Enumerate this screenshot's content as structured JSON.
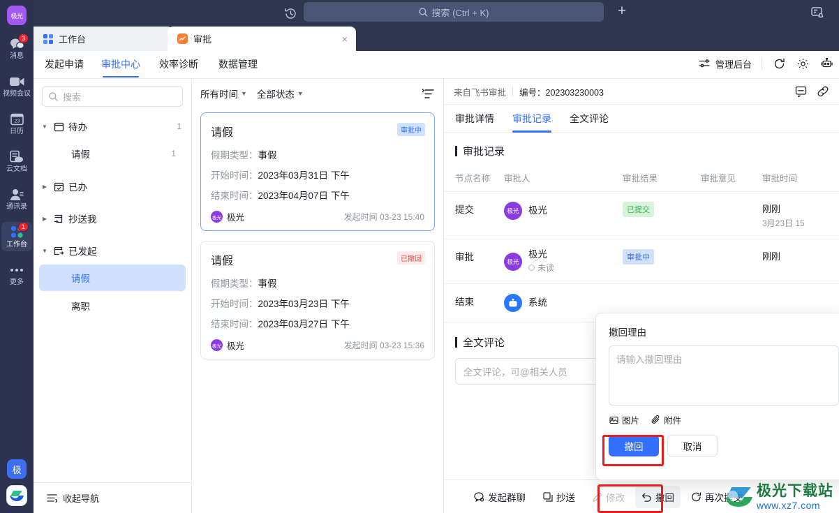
{
  "rail": {
    "avatar_label": "极光",
    "items": [
      {
        "label": "消息",
        "icon": "chat-icon",
        "badge": "3",
        "active": false
      },
      {
        "label": "视频会议",
        "icon": "video-icon",
        "badge": "",
        "active": false
      },
      {
        "label": "日历",
        "icon": "calendar-icon",
        "badge": "",
        "active": false
      },
      {
        "label": "云文档",
        "icon": "cloud-doc-icon",
        "badge": "",
        "active": false
      },
      {
        "label": "通讯录",
        "icon": "contacts-icon",
        "badge": "",
        "active": false
      },
      {
        "label": "工作台",
        "icon": "workbench-icon",
        "badge": "1",
        "active": true
      },
      {
        "label": "更多",
        "icon": "more-dots-icon",
        "badge": "",
        "active": false
      }
    ],
    "bottom_square_label": "极",
    "calendar_day": "23"
  },
  "topbar": {
    "history_icon": "history-icon",
    "search_placeholder": "搜索 (Ctrl + K)",
    "plus_label": "+",
    "notice_icon": "screen-bell-icon"
  },
  "tabs": [
    {
      "label": "工作台",
      "icon": "grid-icon",
      "active": false,
      "closable": false
    },
    {
      "label": "审批",
      "icon": "approval-icon",
      "active": true,
      "closable": true,
      "close_label": "×"
    }
  ],
  "nav": {
    "tabs": [
      {
        "label": "发起申请",
        "active": false
      },
      {
        "label": "审批中心",
        "active": true
      },
      {
        "label": "效率诊断",
        "active": false
      },
      {
        "label": "数据管理",
        "active": false
      }
    ],
    "admin_label": "管理后台",
    "icons": [
      "sliders-icon",
      "refresh-icon",
      "gear-icon",
      "robot-icon"
    ]
  },
  "tree": {
    "search_placeholder": "搜索",
    "groups": [
      {
        "label": "待办",
        "icon": "todo-icon",
        "expanded": true,
        "count": "1",
        "children": [
          {
            "label": "请假",
            "count": "1",
            "selected": false
          }
        ]
      },
      {
        "label": "已办",
        "icon": "done-icon",
        "expanded": false,
        "count": "",
        "children": []
      },
      {
        "label": "抄送我",
        "icon": "cc-icon",
        "expanded": false,
        "count": "",
        "children": []
      },
      {
        "label": "已发起",
        "icon": "initiated-icon",
        "expanded": true,
        "count": "",
        "children": [
          {
            "label": "请假",
            "count": "",
            "selected": true
          },
          {
            "label": "离职",
            "count": "",
            "selected": false
          }
        ]
      }
    ],
    "collapse_label": "收起导航"
  },
  "list": {
    "filters": [
      {
        "label": "所有时间"
      },
      {
        "label": "全部状态"
      }
    ],
    "sort_icon": "sort-icon",
    "cards": [
      {
        "title": "请假",
        "status": "审批中",
        "status_kind": "blue",
        "active": true,
        "fields": [
          {
            "key": "假期类型：",
            "value": "事假"
          },
          {
            "key": "开始时间：",
            "value": "2023年03月31日 下午"
          },
          {
            "key": "结束时间：",
            "value": "2023年04月07日 下午"
          }
        ],
        "author": "极光",
        "avatar_text": "极光",
        "time": "发起时间 03-23 15:40"
      },
      {
        "title": "请假",
        "status": "已撤回",
        "status_kind": "red",
        "active": false,
        "fields": [
          {
            "key": "假期类型：",
            "value": "事假"
          },
          {
            "key": "开始时间：",
            "value": "2023年03月23日 下午"
          },
          {
            "key": "结束时间：",
            "value": "2023年03月27日 下午"
          }
        ],
        "author": "极光",
        "avatar_text": "极光",
        "time": "发起时间 03-23 15:36"
      }
    ]
  },
  "detail": {
    "source": "来自飞书审批",
    "number": "编号：202303230003",
    "head_icons": [
      "comment-icon",
      "link-icon"
    ],
    "tabs": [
      {
        "label": "审批详情",
        "active": false
      },
      {
        "label": "审批记录",
        "active": true
      },
      {
        "label": "全文评论",
        "active": false
      }
    ],
    "record_title": "审批记录",
    "columns": [
      "节点名称",
      "审批人",
      "审批结果",
      "审批意见",
      "审批时间"
    ],
    "rows": [
      {
        "node": "提交",
        "user": "极光",
        "avatar_text": "极光",
        "avatar_kind": "purple",
        "sub": "",
        "result": "已提交",
        "result_kind": "green",
        "opinion": "",
        "time_main": "刚刚",
        "time_sub": "3月23日 15"
      },
      {
        "node": "审批",
        "user": "极光",
        "avatar_text": "极光",
        "avatar_kind": "purple",
        "sub": "未读",
        "result": "审批中",
        "result_kind": "blue",
        "opinion": "",
        "time_main": "刚刚",
        "time_sub": ""
      },
      {
        "node": "结束",
        "user": "系统",
        "avatar_text": "robot-icon",
        "avatar_kind": "blue",
        "sub": "",
        "result": "",
        "result_kind": "",
        "opinion": "",
        "time_main": "",
        "time_sub": ""
      }
    ],
    "comment_title": "全文评论",
    "comment_placeholder": "全文评论，可@相关人员"
  },
  "actions": [
    {
      "label": "发起群聊",
      "icon": "group-chat-icon",
      "disabled": false,
      "hovered": false
    },
    {
      "label": "抄送",
      "icon": "cc-send-icon",
      "disabled": false,
      "hovered": false
    },
    {
      "label": "修改",
      "icon": "edit-icon",
      "disabled": true,
      "hovered": false
    },
    {
      "label": "撤回",
      "icon": "undo-icon",
      "disabled": false,
      "hovered": true
    },
    {
      "label": "再次提交",
      "icon": "resubmit-icon",
      "disabled": false,
      "hovered": false
    }
  ],
  "popup": {
    "label": "撤回理由",
    "textarea_placeholder": "请输入撤回理由",
    "attachments": [
      {
        "label": "图片",
        "icon": "image-icon"
      },
      {
        "label": "附件",
        "icon": "paperclip-icon"
      }
    ],
    "confirm_label": "撤回",
    "cancel_label": "取消"
  },
  "watermark": {
    "title": "极光下载站",
    "url": "www.xz7.com"
  },
  "colors": {
    "accent": "#3370ff",
    "rail_bg": "#2b3350",
    "topbar_bg": "#2e3650",
    "highlight_red": "#e81f1f",
    "avatar_purple": "#8b3ce0",
    "chip_green": "#34b349",
    "chip_red": "#f54a45"
  }
}
